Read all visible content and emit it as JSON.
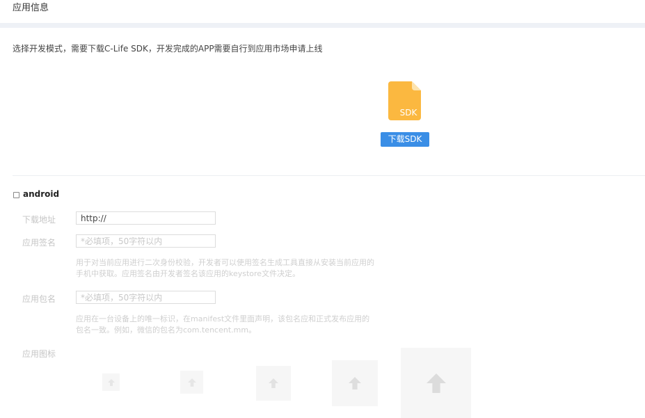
{
  "header": {
    "title": "应用信息"
  },
  "mode": {
    "description": "选择开发模式，需要下载C-Life SDK，开发完成的APP需要自行到应用市场申请上线",
    "sdk_icon_label": "SDK",
    "download_button": "下载SDK"
  },
  "android": {
    "checkbox_label": "android",
    "download_address": {
      "label": "下载地址",
      "value": "http://"
    },
    "app_signature": {
      "label": "应用签名",
      "placeholder": "*必填项，50字符以内",
      "hint": "用于对当前应用进行二次身份校验，开发者可以使用签名生成工具直接从安装当前应用的手机中获取。应用签名由开发者签名该应用的keystore文件决定。"
    },
    "package_name": {
      "label": "应用包名",
      "placeholder": "*必填项，50字符以内",
      "hint": "应用在一台设备上的唯一标识，在manifest文件里面声明，该包名应和正式发布应用的包名一致。例如，微信的包名为com.tencent.mm。"
    },
    "app_icon": {
      "label": "应用图标"
    }
  },
  "colors": {
    "accent": "#3a8ee6",
    "sdk_icon": "#fbb840",
    "separator": "#eef1f6"
  }
}
